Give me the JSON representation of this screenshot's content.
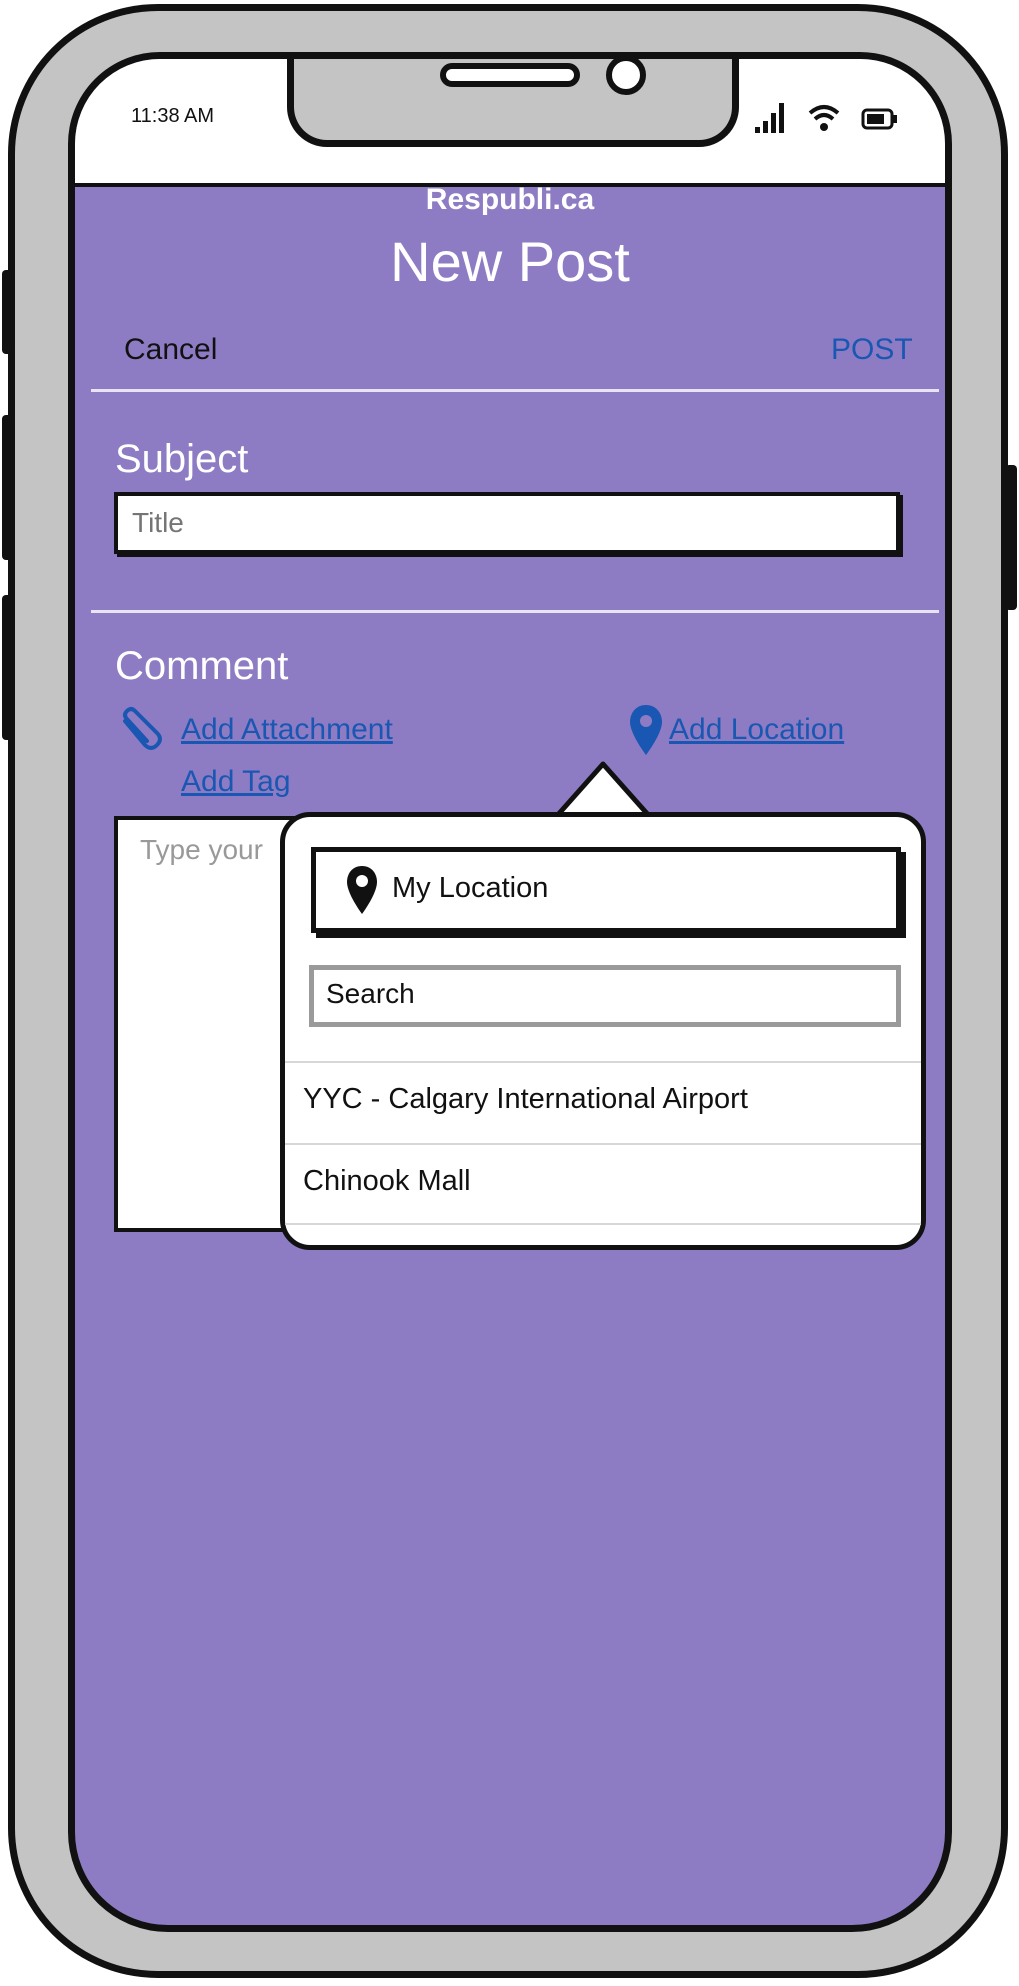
{
  "status_bar": {
    "time": "11:38 AM"
  },
  "header": {
    "app_name": "Respubli.ca",
    "title": "New Post",
    "cancel_label": "Cancel",
    "post_label": "POST"
  },
  "subject": {
    "label": "Subject",
    "placeholder": "Title"
  },
  "comment": {
    "label": "Comment",
    "add_attachment_label": "Add Attachment",
    "add_location_label": "Add Location",
    "add_tag_label": "Add Tag",
    "placeholder": "Type your"
  },
  "location_popover": {
    "my_location_label": "My Location",
    "search_placeholder": "Search",
    "results": [
      {
        "label": "YYC - Calgary International Airport"
      },
      {
        "label": "Chinook Mall"
      }
    ]
  },
  "colors": {
    "background": "#8d7cc3",
    "link": "#1a57b3",
    "frame": "#c4c4c4"
  },
  "icons": [
    "paperclip-icon",
    "map-pin-icon",
    "signal-icon",
    "wifi-icon",
    "battery-icon"
  ]
}
